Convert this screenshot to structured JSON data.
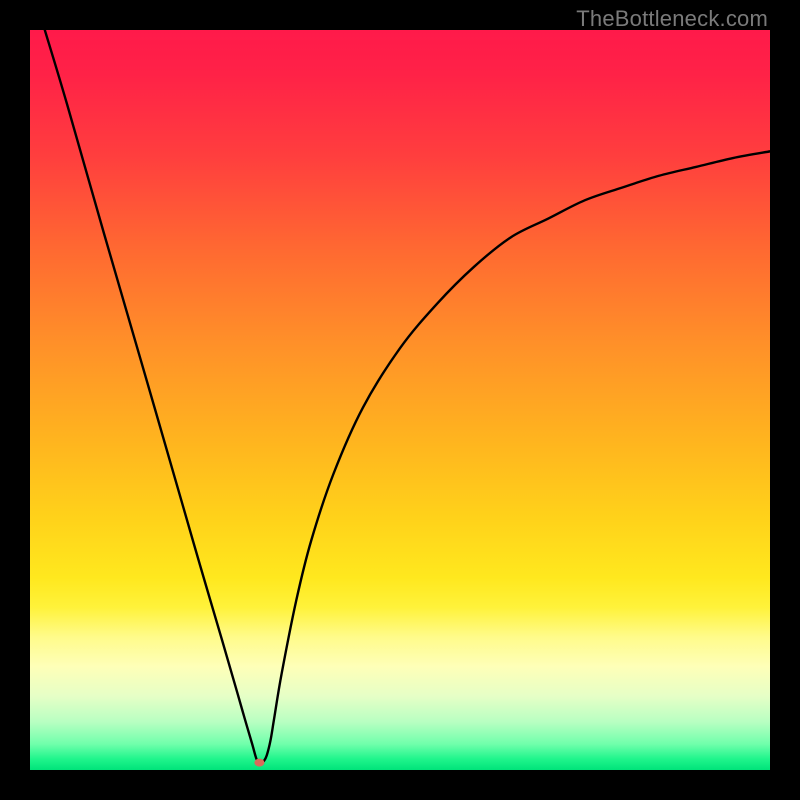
{
  "watermark": "TheBottleneck.com",
  "chart_data": {
    "type": "line",
    "title": "",
    "xlabel": "",
    "ylabel": "",
    "xlim": [
      0,
      100
    ],
    "ylim": [
      0,
      100
    ],
    "background_gradient": {
      "stops": [
        {
          "offset": 0.0,
          "color": "#ff1a4a"
        },
        {
          "offset": 0.06,
          "color": "#ff2247"
        },
        {
          "offset": 0.17,
          "color": "#ff3e3e"
        },
        {
          "offset": 0.3,
          "color": "#ff6a31"
        },
        {
          "offset": 0.42,
          "color": "#ff8f29"
        },
        {
          "offset": 0.55,
          "color": "#ffb31f"
        },
        {
          "offset": 0.66,
          "color": "#ffd21a"
        },
        {
          "offset": 0.74,
          "color": "#ffe81e"
        },
        {
          "offset": 0.78,
          "color": "#fff23a"
        },
        {
          "offset": 0.82,
          "color": "#fffb8a"
        },
        {
          "offset": 0.86,
          "color": "#feffb8"
        },
        {
          "offset": 0.9,
          "color": "#e6ffc6"
        },
        {
          "offset": 0.935,
          "color": "#b8ffc2"
        },
        {
          "offset": 0.965,
          "color": "#70ffab"
        },
        {
          "offset": 0.985,
          "color": "#20f58c"
        },
        {
          "offset": 1.0,
          "color": "#00e37a"
        }
      ]
    },
    "series": [
      {
        "name": "bottleneck-curve",
        "color": "#000000",
        "x": [
          2,
          5,
          10,
          15,
          20,
          23,
          26,
          28,
          29,
          30,
          30.5,
          30.8,
          31,
          31.3,
          31.6,
          32,
          32.5,
          33,
          34,
          36,
          38,
          41,
          45,
          50,
          55,
          60,
          65,
          70,
          75,
          80,
          85,
          90,
          95,
          100
        ],
        "y": [
          100,
          90,
          72.5,
          55.3,
          38,
          27.6,
          17.4,
          10.5,
          7,
          3.6,
          1.8,
          1,
          1,
          1,
          1.2,
          2,
          4,
          7,
          13,
          23,
          31,
          40,
          49,
          57,
          63,
          68,
          72,
          74.5,
          77,
          78.7,
          80.3,
          81.5,
          82.7,
          83.6
        ]
      }
    ],
    "marker": {
      "x": 31,
      "y": 1,
      "rx": 5,
      "ry": 4,
      "color": "#d96a5a"
    },
    "grid": false,
    "legend": false
  }
}
